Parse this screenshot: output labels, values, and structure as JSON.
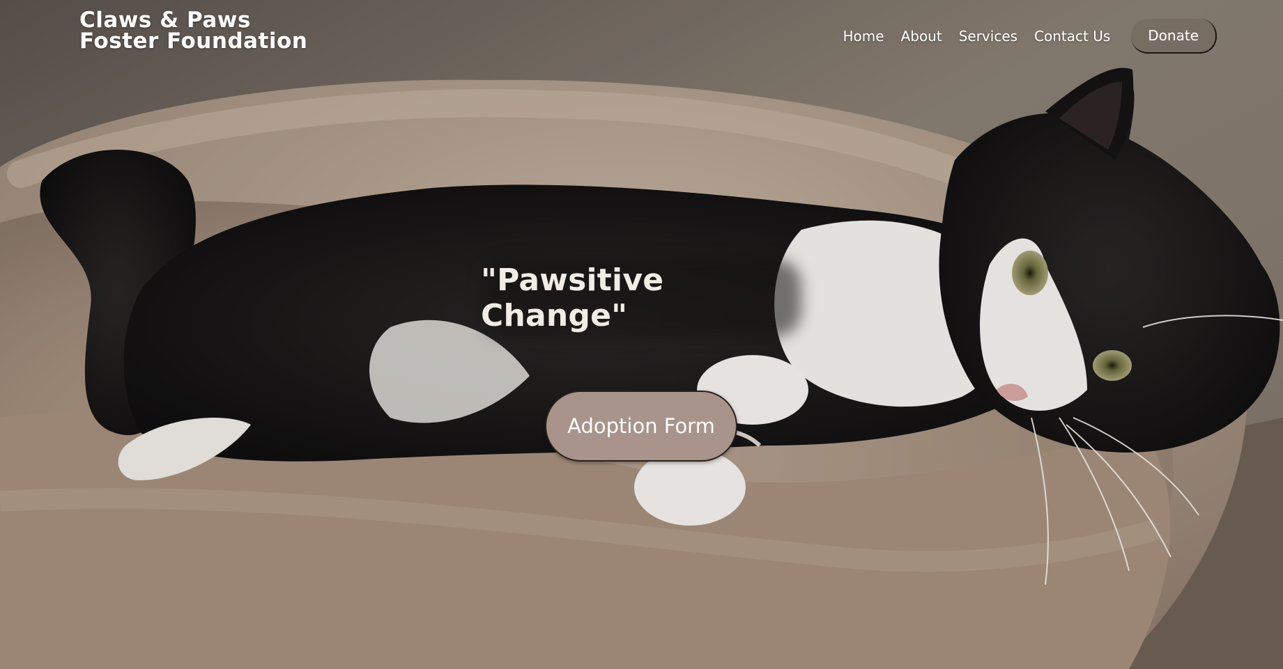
{
  "brand": {
    "line1": "Claws & Paws",
    "line2": "Foster Foundation"
  },
  "nav": {
    "items": [
      {
        "label": "Home"
      },
      {
        "label": "About"
      },
      {
        "label": "Services"
      },
      {
        "label": "Contact Us"
      }
    ],
    "donate_label": "Donate"
  },
  "hero": {
    "tagline": "\"Pawsitive Change\"",
    "cta_label": "Adoption Form",
    "image_subject": "black and white cat lying in a plush beige pet bed"
  },
  "colors": {
    "cta_background": "#a8948a",
    "text": "#ffffff",
    "bed": "#a99583",
    "backdrop": "#6f665d"
  }
}
